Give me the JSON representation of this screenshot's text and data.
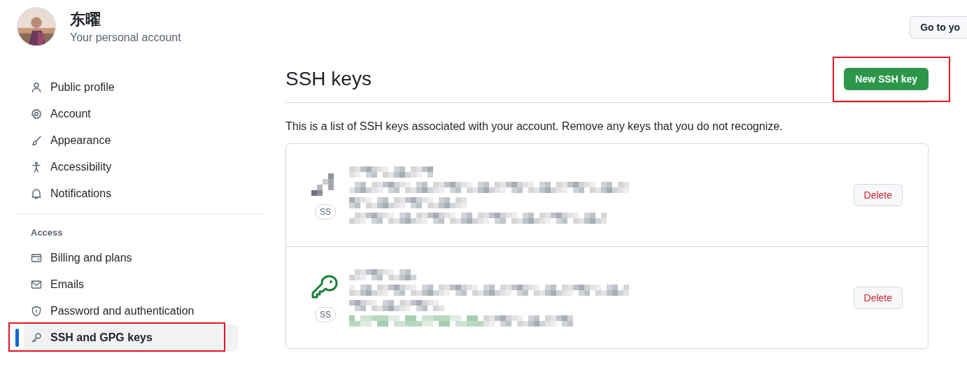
{
  "account": {
    "name": "东曜",
    "subtitle": "Your personal account",
    "button": "Go to yo"
  },
  "sidebar": {
    "groups": [
      {
        "items": [
          {
            "label": "Public profile",
            "selected": false,
            "highlighted": false
          },
          {
            "label": "Account",
            "selected": false,
            "highlighted": false
          },
          {
            "label": "Appearance",
            "selected": false,
            "highlighted": false
          },
          {
            "label": "Accessibility",
            "selected": false,
            "highlighted": false
          },
          {
            "label": "Notifications",
            "selected": false,
            "highlighted": false
          }
        ]
      },
      {
        "heading": "Access",
        "items": [
          {
            "label": "Billing and plans",
            "selected": false,
            "highlighted": false
          },
          {
            "label": "Emails",
            "selected": false,
            "highlighted": false
          },
          {
            "label": "Password and authentication",
            "selected": false,
            "highlighted": false
          },
          {
            "label": "SSH and GPG keys",
            "selected": true,
            "highlighted": true
          }
        ]
      }
    ]
  },
  "main": {
    "title": "SSH keys",
    "new_button": {
      "label": "New SSH key",
      "highlighted": true
    },
    "description": "This is a list of SSH keys associated with your account. Remove any keys that you do not recognize.",
    "keys": [
      {
        "kind": "redacted",
        "badge": "SS",
        "delete": "Delete"
      },
      {
        "kind": "key",
        "badge": "SS",
        "delete": "Delete"
      }
    ]
  }
}
